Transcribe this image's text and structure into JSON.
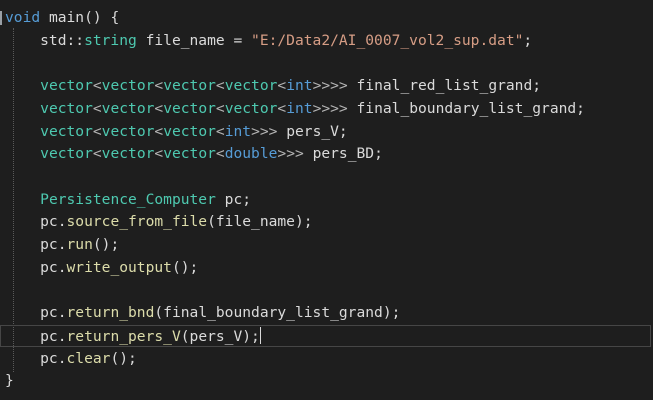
{
  "editor": {
    "lines": [
      {
        "tokens": [
          [
            "kw",
            "void"
          ],
          [
            "var",
            " main() {"
          ]
        ]
      },
      {
        "tokens": [
          [
            "var",
            "    std::"
          ],
          [
            "ty",
            "string"
          ],
          [
            "var",
            " file_name = "
          ],
          [
            "str",
            "\"E:/Data2/AI_0007_vol2_sup.dat\""
          ],
          [
            "var",
            ";"
          ]
        ]
      },
      {
        "tokens": [
          [
            "var",
            ""
          ]
        ]
      },
      {
        "tokens": [
          [
            "var",
            "    "
          ],
          [
            "ty",
            "vector"
          ],
          [
            "op",
            "<"
          ],
          [
            "ty",
            "vector"
          ],
          [
            "op",
            "<"
          ],
          [
            "ty",
            "vector"
          ],
          [
            "op",
            "<"
          ],
          [
            "ty",
            "vector"
          ],
          [
            "op",
            "<"
          ],
          [
            "kw",
            "int"
          ],
          [
            "op",
            ">>>>"
          ],
          [
            "var",
            " final_red_list_grand;"
          ]
        ]
      },
      {
        "tokens": [
          [
            "var",
            "    "
          ],
          [
            "ty",
            "vector"
          ],
          [
            "op",
            "<"
          ],
          [
            "ty",
            "vector"
          ],
          [
            "op",
            "<"
          ],
          [
            "ty",
            "vector"
          ],
          [
            "op",
            "<"
          ],
          [
            "ty",
            "vector"
          ],
          [
            "op",
            "<"
          ],
          [
            "kw",
            "int"
          ],
          [
            "op",
            ">>>>"
          ],
          [
            "var",
            " final_boundary_list_grand;"
          ]
        ]
      },
      {
        "tokens": [
          [
            "var",
            "    "
          ],
          [
            "ty",
            "vector"
          ],
          [
            "op",
            "<"
          ],
          [
            "ty",
            "vector"
          ],
          [
            "op",
            "<"
          ],
          [
            "ty",
            "vector"
          ],
          [
            "op",
            "<"
          ],
          [
            "kw",
            "int"
          ],
          [
            "op",
            ">>>"
          ],
          [
            "var",
            " pers_V;"
          ]
        ]
      },
      {
        "tokens": [
          [
            "var",
            "    "
          ],
          [
            "ty",
            "vector"
          ],
          [
            "op",
            "<"
          ],
          [
            "ty",
            "vector"
          ],
          [
            "op",
            "<"
          ],
          [
            "ty",
            "vector"
          ],
          [
            "op",
            "<"
          ],
          [
            "kw",
            "double"
          ],
          [
            "op",
            ">>>"
          ],
          [
            "var",
            " pers_BD;"
          ]
        ]
      },
      {
        "tokens": [
          [
            "var",
            ""
          ]
        ]
      },
      {
        "tokens": [
          [
            "var",
            "    "
          ],
          [
            "ty",
            "Persistence_Computer"
          ],
          [
            "var",
            " pc;"
          ]
        ]
      },
      {
        "tokens": [
          [
            "var",
            "    pc."
          ],
          [
            "fn",
            "source_from_file"
          ],
          [
            "var",
            "(file_name);"
          ]
        ]
      },
      {
        "tokens": [
          [
            "var",
            "    pc."
          ],
          [
            "fn",
            "run"
          ],
          [
            "var",
            "();"
          ]
        ]
      },
      {
        "tokens": [
          [
            "var",
            "    pc."
          ],
          [
            "fn",
            "write_output"
          ],
          [
            "var",
            "();"
          ]
        ]
      },
      {
        "tokens": [
          [
            "var",
            ""
          ]
        ]
      },
      {
        "tokens": [
          [
            "var",
            "    pc."
          ],
          [
            "fn",
            "return_bnd"
          ],
          [
            "var",
            "(final_boundary_list_grand);"
          ]
        ]
      },
      {
        "tokens": [
          [
            "var",
            "    pc."
          ],
          [
            "fn",
            "return_pers_V"
          ],
          [
            "var",
            "(pers_V);"
          ]
        ],
        "current": true
      },
      {
        "tokens": [
          [
            "var",
            "    pc."
          ],
          [
            "fn",
            "clear"
          ],
          [
            "var",
            "();"
          ]
        ]
      },
      {
        "tokens": [
          [
            "var",
            "}"
          ]
        ]
      }
    ]
  }
}
